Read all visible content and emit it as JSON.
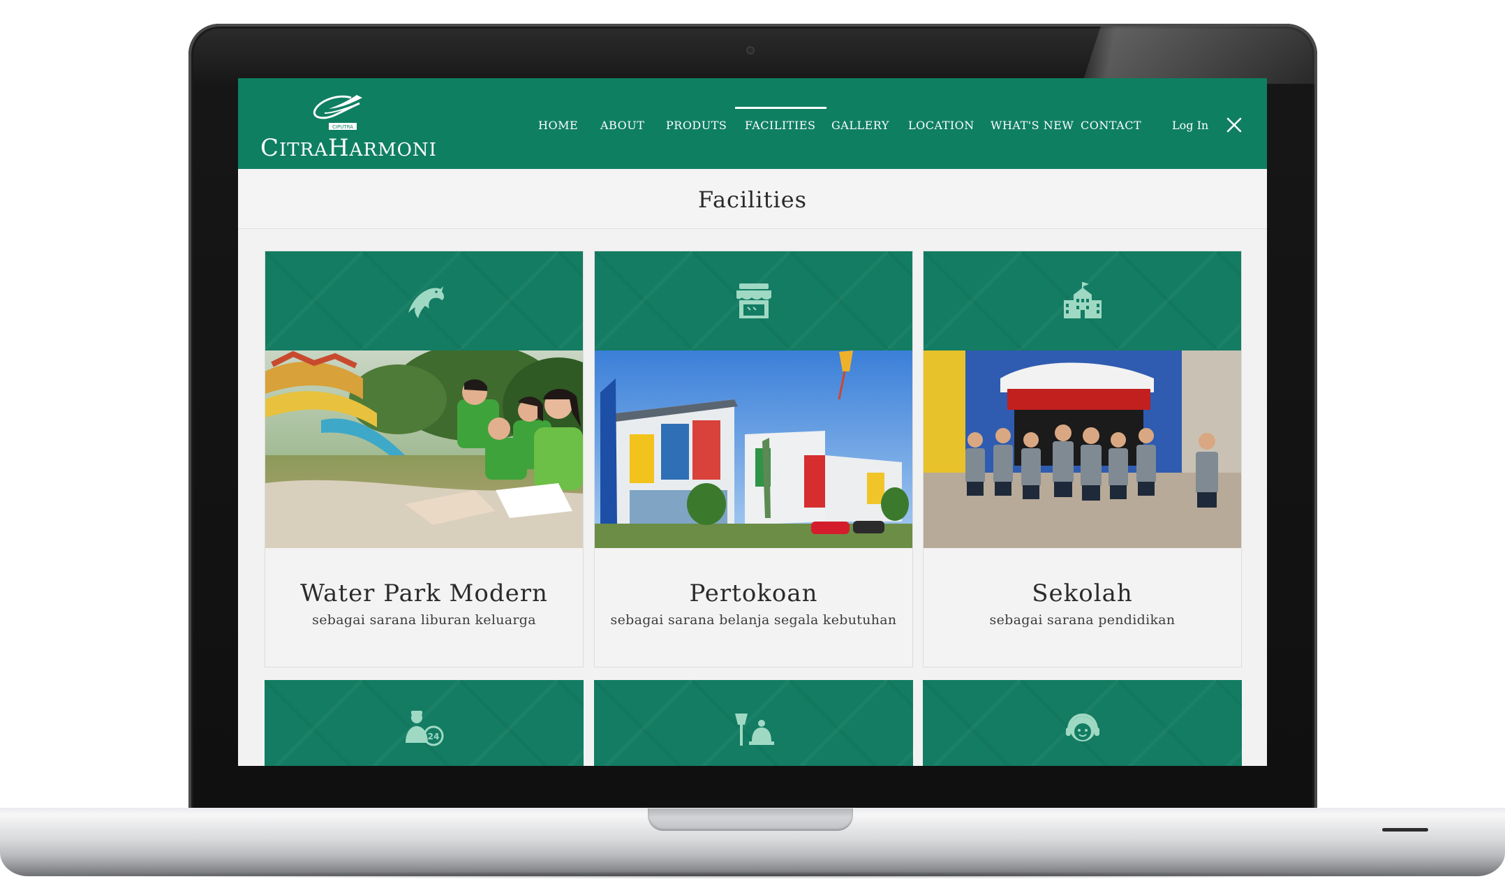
{
  "brand": {
    "logo_small": "CIPUTRA",
    "logo_name_big1": "C",
    "logo_name_small1": "ITRA",
    "logo_name_big2": "H",
    "logo_name_small2": "ARMONI"
  },
  "nav": {
    "items": [
      "HOME",
      "ABOUT",
      "PRODUTS",
      "FACILITIES",
      "GALLERY",
      "LOCATION",
      "WHAT'S NEW",
      "CONTACT"
    ],
    "active": "FACILITIES",
    "login": "Log In"
  },
  "page": {
    "title": "Facilities"
  },
  "facilities": [
    {
      "icon": "dolphin-icon",
      "title": "Water Park Modern",
      "subtitle": "sebagai sarana liburan keluarga"
    },
    {
      "icon": "shop-icon",
      "title": "Pertokoan",
      "subtitle": "sebagai sarana belanja segala kebutuhan"
    },
    {
      "icon": "school-icon",
      "title": "Sekolah",
      "subtitle": "sebagai sarana pendidikan"
    },
    {
      "icon": "security-24-icon"
    },
    {
      "icon": "cleaning-service-icon"
    },
    {
      "icon": "customer-service-icon"
    }
  ],
  "colors": {
    "brand_green": "#0f7f62",
    "card_header_green": "#137c62",
    "page_bg": "#f2f2f2"
  }
}
